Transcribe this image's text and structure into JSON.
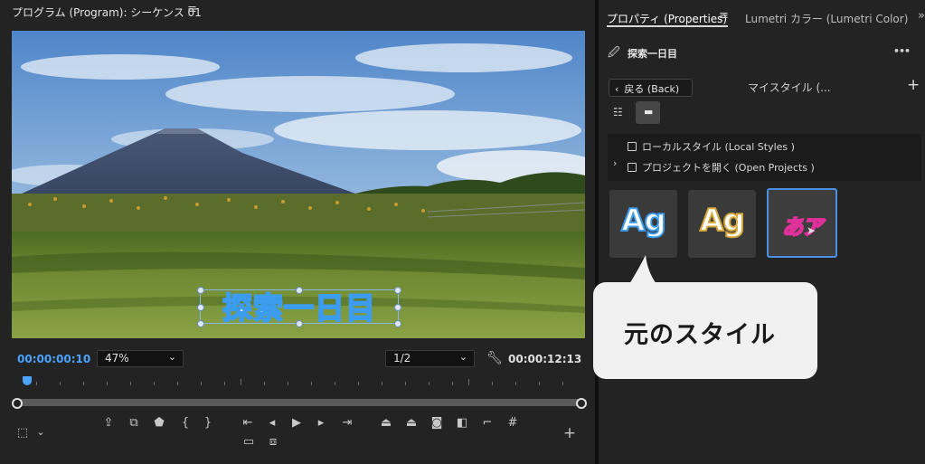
{
  "program_monitor": {
    "title": "プログラム (Program): シーケンス 01",
    "menu_icon": "hamburger-icon",
    "overlay_title": "探索一日目",
    "current_timecode": "00:00:00:10",
    "zoom": "47%",
    "resolution": "1/2",
    "duration_timecode": "00:00:12:13",
    "playhead_position": 0.02,
    "colors": {
      "timecode_blue": "#4aa3ff",
      "title_fill": "#ffffff",
      "title_outline": "#3b9cf0"
    }
  },
  "properties_panel": {
    "tabs": [
      {
        "label": "プロパティ (Properties)",
        "active": true
      },
      {
        "label": "Lumetri カラー (Lumetri Color)",
        "active": false
      }
    ],
    "object_name": "探索一日目",
    "more_label": "•••",
    "back_label": "戻る (Back)",
    "style_header": "マイスタイル (...",
    "add_label": "+",
    "view_icons": [
      "list-view-icon",
      "grid-view-icon"
    ],
    "tree_items": [
      {
        "label": "ローカルスタイル (Local Styles )"
      },
      {
        "label": "プロジェクトを開く (Open Projects )"
      }
    ],
    "styles": [
      {
        "text": "Ag",
        "fill": "#ffffff",
        "outline": "#3b9cf0"
      },
      {
        "text": "Ag",
        "fill": "#ffffff",
        "outline": "#d4a83a"
      },
      {
        "text": "あア",
        "fill": "#ffffff",
        "outline": "#e0309a"
      }
    ]
  },
  "callout": {
    "text": "元のスタイル"
  }
}
